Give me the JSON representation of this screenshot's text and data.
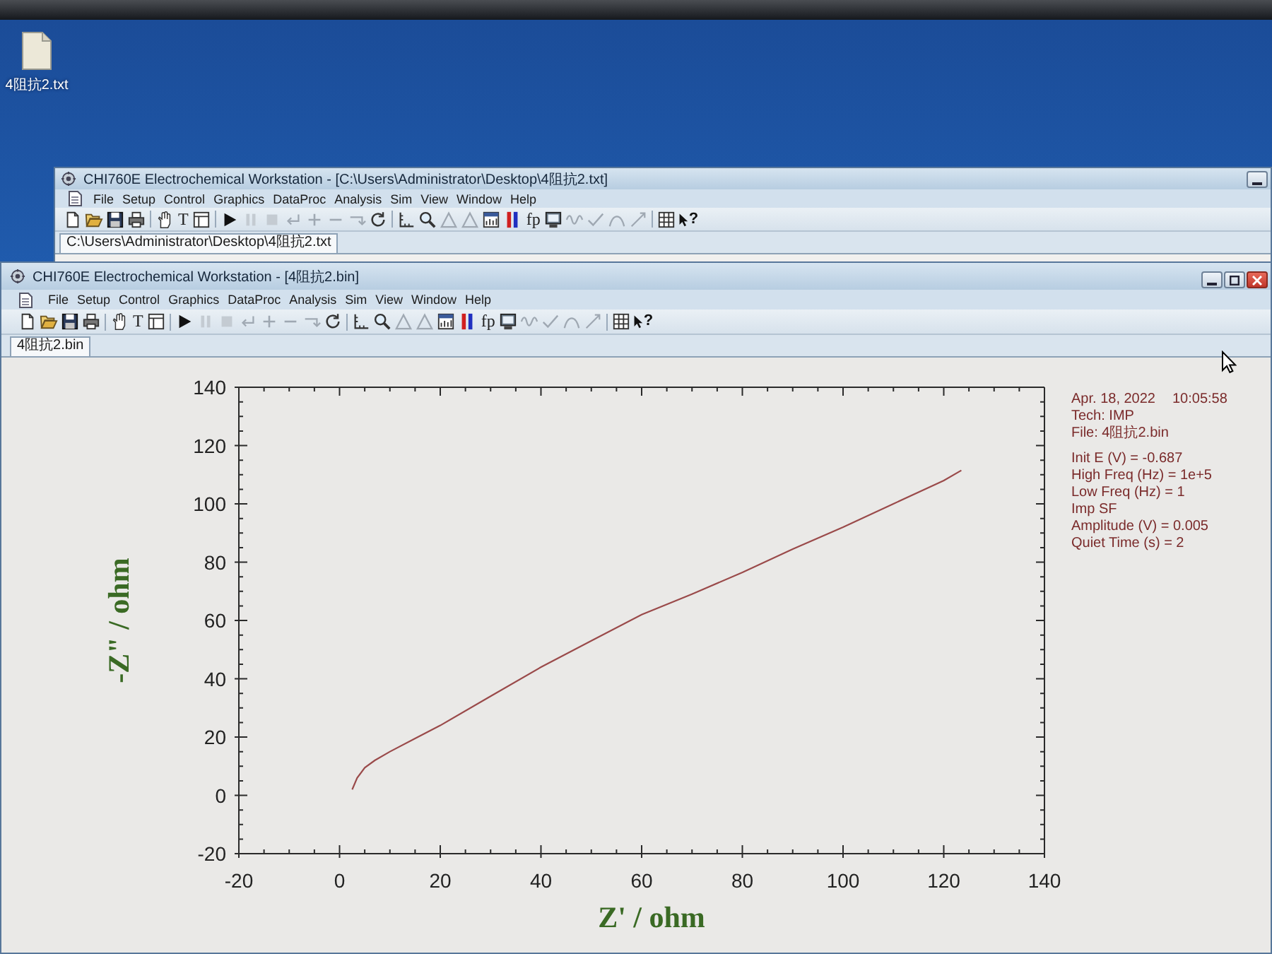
{
  "desktop": {
    "icons": [
      {
        "label": "4阻抗2.txt"
      }
    ]
  },
  "windows": [
    {
      "title": "CHI760E Electrochemical Workstation - [C:\\Users\\Administrator\\Desktop\\4阻抗2.txt]",
      "menu": [
        "File",
        "Setup",
        "Control",
        "Graphics",
        "DataProc",
        "Analysis",
        "Sim",
        "View",
        "Window",
        "Help"
      ],
      "toolbar": [
        {
          "buttons": [
            {
              "kind": "new",
              "disabled": false
            },
            {
              "kind": "open",
              "disabled": false
            },
            {
              "kind": "save",
              "disabled": false
            },
            {
              "kind": "print",
              "disabled": false
            }
          ]
        },
        {
          "buttons": [
            {
              "kind": "hand",
              "disabled": false
            },
            {
              "kind": "glyph",
              "glyph": "T",
              "disabled": false
            },
            {
              "kind": "panel",
              "disabled": false
            }
          ]
        },
        {
          "buttons": [
            {
              "kind": "play",
              "disabled": false
            },
            {
              "kind": "pause",
              "disabled": true
            },
            {
              "kind": "stop",
              "disabled": true
            },
            {
              "kind": "undo",
              "disabled": true
            },
            {
              "kind": "plus",
              "disabled": true
            },
            {
              "kind": "minus",
              "disabled": true
            },
            {
              "kind": "corner",
              "disabled": true
            },
            {
              "kind": "refresh",
              "disabled": false
            }
          ]
        },
        {
          "buttons": [
            {
              "kind": "axes",
              "disabled": false
            },
            {
              "kind": "zoom",
              "disabled": false
            },
            {
              "kind": "peak",
              "disabled": true
            },
            {
              "kind": "peak",
              "disabled": true
            },
            {
              "kind": "chart",
              "disabled": false
            },
            {
              "kind": "bars",
              "disabled": false
            },
            {
              "kind": "glyph",
              "glyph": "fp",
              "disabled": false
            },
            {
              "kind": "calc",
              "disabled": false
            },
            {
              "kind": "wave",
              "disabled": true
            },
            {
              "kind": "tick",
              "disabled": true
            },
            {
              "kind": "curve",
              "disabled": true
            },
            {
              "kind": "slash",
              "disabled": true
            }
          ]
        },
        {
          "buttons": [
            {
              "kind": "grid",
              "disabled": false
            },
            {
              "kind": "help",
              "glyph": "?",
              "disabled": false
            }
          ]
        }
      ],
      "tabs": [
        {
          "label": "C:\\Users\\Administrator\\Desktop\\4阻抗2.txt",
          "selected": true
        }
      ]
    },
    {
      "title": "CHI760E Electrochemical Workstation - [4阻抗2.bin]",
      "menu": [
        "File",
        "Setup",
        "Control",
        "Graphics",
        "DataProc",
        "Analysis",
        "Sim",
        "View",
        "Window",
        "Help"
      ],
      "toolbar": [
        {
          "buttons": [
            {
              "kind": "new",
              "disabled": false
            },
            {
              "kind": "open",
              "disabled": false
            },
            {
              "kind": "save",
              "disabled": false
            },
            {
              "kind": "print",
              "disabled": false
            }
          ]
        },
        {
          "buttons": [
            {
              "kind": "hand",
              "disabled": false
            },
            {
              "kind": "glyph",
              "glyph": "T",
              "disabled": false
            },
            {
              "kind": "panel",
              "disabled": false
            }
          ]
        },
        {
          "buttons": [
            {
              "kind": "play",
              "disabled": false
            },
            {
              "kind": "pause",
              "disabled": true
            },
            {
              "kind": "stop",
              "disabled": true
            },
            {
              "kind": "undo",
              "disabled": true
            },
            {
              "kind": "plus",
              "disabled": true
            },
            {
              "kind": "minus",
              "disabled": true
            },
            {
              "kind": "corner",
              "disabled": true
            },
            {
              "kind": "refresh",
              "disabled": false
            }
          ]
        },
        {
          "buttons": [
            {
              "kind": "axes",
              "disabled": false
            },
            {
              "kind": "zoom",
              "disabled": false
            },
            {
              "kind": "peak",
              "disabled": true
            },
            {
              "kind": "peak",
              "disabled": true
            },
            {
              "kind": "chart",
              "disabled": false
            },
            {
              "kind": "bars",
              "disabled": false
            },
            {
              "kind": "glyph",
              "glyph": "fp",
              "disabled": false
            },
            {
              "kind": "calc",
              "disabled": false
            },
            {
              "kind": "wave",
              "disabled": true
            },
            {
              "kind": "tick",
              "disabled": true
            },
            {
              "kind": "curve",
              "disabled": true
            },
            {
              "kind": "slash",
              "disabled": true
            }
          ]
        },
        {
          "buttons": [
            {
              "kind": "grid",
              "disabled": false
            },
            {
              "kind": "help",
              "glyph": "?",
              "disabled": false
            }
          ]
        }
      ],
      "tabs": [
        {
          "label": "4阻抗2.bin",
          "selected": true
        }
      ],
      "plot": {
        "chart_data": {
          "type": "line",
          "xlabel": "Z' / ohm",
          "ylabel": "-Z\" / ohm",
          "x": [
            2.5,
            3.5,
            5,
            7,
            10,
            15,
            20,
            30,
            40,
            50,
            60,
            70,
            80,
            90,
            100,
            110,
            120,
            123.5
          ],
          "series": [
            {
              "color": "#9a4a4a",
              "values": [
                2,
                6,
                9.5,
                12,
                15,
                19.5,
                24,
                34,
                44,
                53,
                62,
                69,
                76.5,
                84.5,
                92,
                100,
                108,
                111.5
              ]
            }
          ],
          "xlim": [
            -20,
            140
          ],
          "ylim": [
            -20,
            140
          ],
          "xticks": [
            -20,
            0,
            20,
            40,
            60,
            80,
            100,
            120,
            140
          ],
          "yticks": [
            -20,
            0,
            20,
            40,
            60,
            80,
            100,
            120,
            140
          ]
        }
      },
      "info": {
        "date": "Apr. 18, 2022",
        "time": "10:05:58",
        "header": [
          "Tech: IMP",
          "File: 4阻抗2.bin"
        ],
        "parameters": [
          "Init E (V) = -0.687",
          "High Freq (Hz) = 1e+5",
          "Low Freq (Hz) = 1",
          "Imp SF",
          "Amplitude (V) = 0.005",
          "Quiet Time (s) = 2"
        ]
      }
    }
  ]
}
